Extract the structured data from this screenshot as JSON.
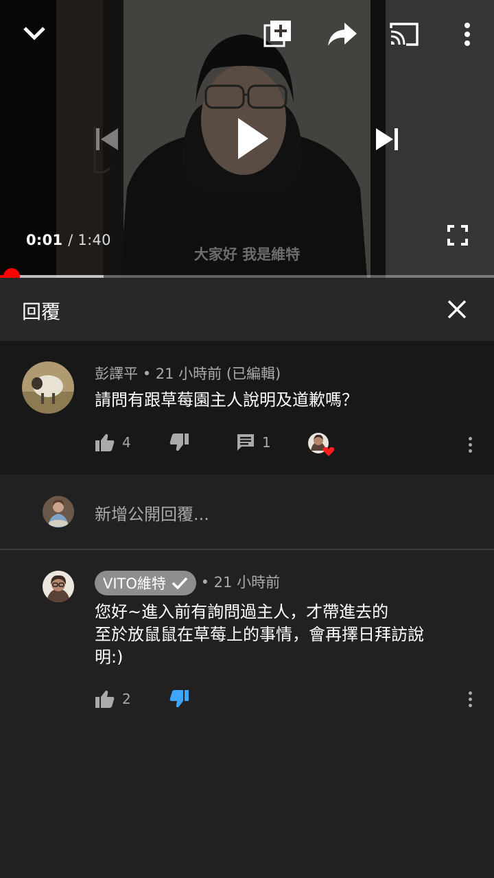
{
  "player": {
    "current_time": "0:01",
    "duration": "/ 1:40",
    "subtitle": "大家好 我是維特",
    "progress_fraction": 0.015,
    "buffered_fraction": 0.21,
    "icons": {
      "collapse": "chevron-down-icon",
      "add_to_playlist": "playlist-add-icon",
      "share": "share-icon",
      "cast": "cast-icon",
      "more": "more-vert-icon",
      "previous": "skip-previous-icon",
      "play": "play-icon",
      "next": "skip-next-icon",
      "fullscreen": "fullscreen-icon"
    }
  },
  "reply_panel": {
    "title": "回覆",
    "close_icon": "close-icon"
  },
  "parent_comment": {
    "author": "彭譯平",
    "time": "• 21 小時前 (已編輯)",
    "text": "請問有跟草莓園主人說明及道歉嗎？",
    "likes": "4",
    "replies": "1"
  },
  "add_reply": {
    "placeholder": "新增公開回覆..."
  },
  "reply": {
    "author": "VITO維特",
    "time": "• 21 小時前",
    "text_line1": "您好~進入前有詢問過主人，才帶進去的",
    "text_line2": "至於放鼠鼠在草莓上的事情，會再擇日拜訪說",
    "text_line3": "明:)",
    "likes": "2",
    "disliked": true
  },
  "colors": {
    "accent_red": "#ff0000",
    "dislike_active": "#3ea6ff",
    "background": "#212121"
  }
}
